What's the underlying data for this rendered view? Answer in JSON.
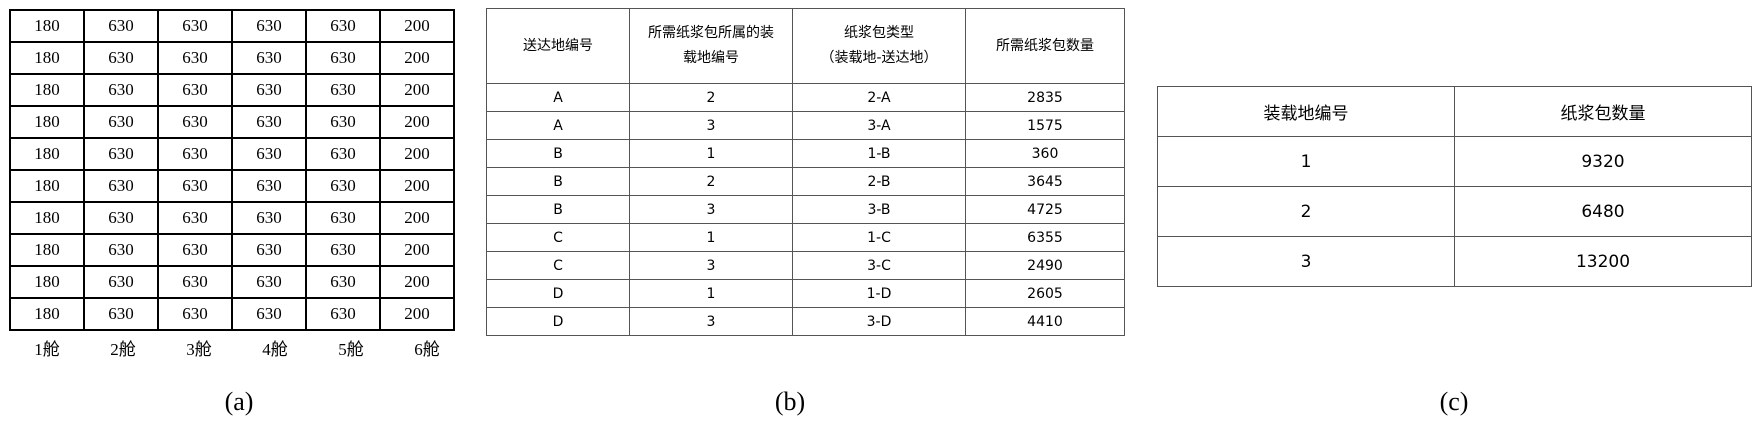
{
  "table_a": {
    "rows": [
      [
        "180",
        "630",
        "630",
        "630",
        "630",
        "200"
      ],
      [
        "180",
        "630",
        "630",
        "630",
        "630",
        "200"
      ],
      [
        "180",
        "630",
        "630",
        "630",
        "630",
        "200"
      ],
      [
        "180",
        "630",
        "630",
        "630",
        "630",
        "200"
      ],
      [
        "180",
        "630",
        "630",
        "630",
        "630",
        "200"
      ],
      [
        "180",
        "630",
        "630",
        "630",
        "630",
        "200"
      ],
      [
        "180",
        "630",
        "630",
        "630",
        "630",
        "200"
      ],
      [
        "180",
        "630",
        "630",
        "630",
        "630",
        "200"
      ],
      [
        "180",
        "630",
        "630",
        "630",
        "630",
        "200"
      ],
      [
        "180",
        "630",
        "630",
        "630",
        "630",
        "200"
      ]
    ],
    "hold_labels": [
      "1舱",
      "2舱",
      "3舱",
      "4舱",
      "5舱",
      "6舱"
    ],
    "caption": "(a)"
  },
  "table_b": {
    "headers": [
      "送达地编号",
      "所需纸浆包所属的装载地编号",
      "纸浆包类型（装载地-送达地）",
      "所需纸浆包数量"
    ],
    "header_lines": [
      [
        "送达地编号"
      ],
      [
        "所需纸浆包所属的装",
        "载地编号"
      ],
      [
        "纸浆包类型",
        "（装载地-送达地）"
      ],
      [
        "所需纸浆包数量"
      ]
    ],
    "rows": [
      [
        "A",
        "2",
        "2-A",
        "2835"
      ],
      [
        "A",
        "3",
        "3-A",
        "1575"
      ],
      [
        "B",
        "1",
        "1-B",
        "360"
      ],
      [
        "B",
        "2",
        "2-B",
        "3645"
      ],
      [
        "B",
        "3",
        "3-B",
        "4725"
      ],
      [
        "C",
        "1",
        "1-C",
        "6355"
      ],
      [
        "C",
        "3",
        "3-C",
        "2490"
      ],
      [
        "D",
        "1",
        "1-D",
        "2605"
      ],
      [
        "D",
        "3",
        "3-D",
        "4410"
      ]
    ],
    "caption": "(b)"
  },
  "table_c": {
    "headers": [
      "装载地编号",
      "纸浆包数量"
    ],
    "rows": [
      [
        "1",
        "9320"
      ],
      [
        "2",
        "6480"
      ],
      [
        "3",
        "13200"
      ]
    ],
    "caption": "(c)"
  }
}
